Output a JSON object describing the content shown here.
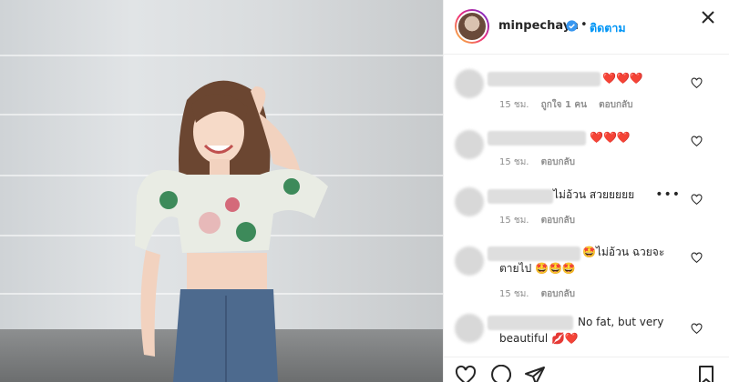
{
  "post": {
    "username": "minpechaya",
    "follow_label": "ติดตาม",
    "separator": "•"
  },
  "comments": [
    {
      "text": "❤️❤️❤️",
      "time": "15 ชม.",
      "likes": "ถูกใจ 1 คน",
      "reply": "ตอบกลับ"
    },
    {
      "text": "❤️❤️❤️",
      "time": "15 ชม.",
      "reply": "ตอบกลับ"
    },
    {
      "text": "ไม่อ้วน สวยยยยย",
      "time": "15 ชม.",
      "reply": "ตอบกลับ",
      "more": "•••"
    },
    {
      "text_line1": "🤩ไม่อ้วน ฉวยจะ",
      "text_line2": "ตายไป 🤩🤩🤩",
      "time": "15 ชม.",
      "reply": "ตอบกลับ"
    },
    {
      "text_line1": "No fat, but very",
      "text_line2": "beautiful 💋❤️"
    }
  ],
  "icons": {
    "verified": "verified-badge-icon",
    "close": "close-icon",
    "like": "heart-icon",
    "comment": "comment-icon",
    "share": "share-icon",
    "save": "bookmark-icon"
  },
  "colors": {
    "link": "#0095f6",
    "heart": "#e0241c",
    "meta": "#8e8e8e"
  }
}
